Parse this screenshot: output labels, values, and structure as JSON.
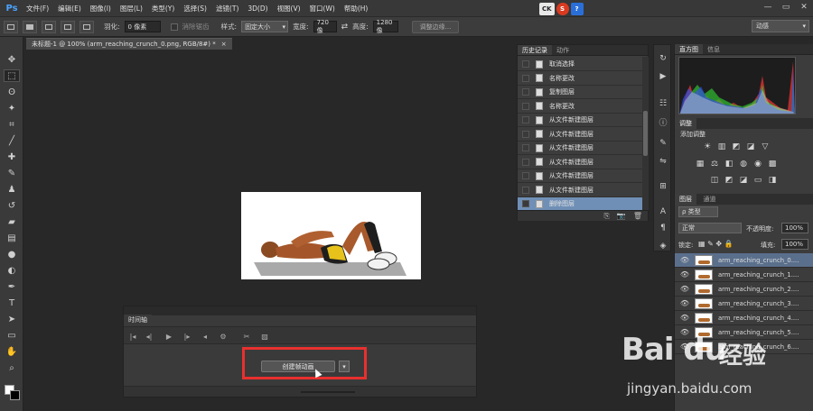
{
  "app": {
    "logo": "Ps",
    "menu": [
      "文件(F)",
      "编辑(E)",
      "图像(I)",
      "图层(L)",
      "类型(Y)",
      "选择(S)",
      "滤镜(T)",
      "3D(D)",
      "视图(V)",
      "窗口(W)",
      "帮助(H)"
    ],
    "tray": [
      "CK",
      "S",
      "?"
    ],
    "window_controls": [
      "—",
      "▭",
      "✕"
    ]
  },
  "options": {
    "feather_label": "羽化:",
    "feather_value": "0 像素",
    "antialias_label": "消除锯齿",
    "style_label": "样式:",
    "style_value": "固定大小",
    "width_label": "宽度:",
    "width_value": "720 像",
    "swap_icon": "⇄",
    "height_label": "高度:",
    "height_value": "1280 像",
    "refine_edge": "调整边缘...",
    "workspace": "动感"
  },
  "document": {
    "tab_title": "未标题-1 @ 100% (arm_reaching_crunch_0.png, RGB/8#) *",
    "close": "×"
  },
  "history": {
    "tabs": [
      "历史记录",
      "动作"
    ],
    "items": [
      "取消选择",
      "名称更改",
      "复制图层",
      "名称更改",
      "从文件新建图层",
      "从文件新建图层",
      "从文件新建图层",
      "从文件新建图层",
      "从文件新建图层",
      "从文件新建图层",
      "删除图层"
    ],
    "selected_index": 10,
    "footer_icons": [
      "⎘",
      "📷",
      "🗑"
    ]
  },
  "right": {
    "histogram_tabs": [
      "直方图",
      "信息"
    ],
    "adjust_tab": "调整",
    "adjust_title": "添加调整",
    "layers_tabs": [
      "图层",
      "通道"
    ],
    "kind_value": "ρ 类型",
    "blend_value": "正常",
    "opacity_label": "不透明度:",
    "opacity_value": "100%",
    "lock_label": "锁定:",
    "fill_label": "填充:",
    "fill_value": "100%",
    "layers": [
      "arm_reaching_crunch_0....",
      "arm_reaching_crunch_1....",
      "arm_reaching_crunch_2....",
      "arm_reaching_crunch_3....",
      "arm_reaching_crunch_4....",
      "arm_reaching_crunch_5....",
      "arm_reaching_crunch_6...."
    ]
  },
  "timeline": {
    "tab": "时间轴",
    "create_button": "创建帧动画",
    "dropdown": "▾",
    "controls": [
      "|◂",
      "◂|",
      "▶",
      "|▸",
      "◂",
      "⚙",
      "✂",
      "▨"
    ]
  },
  "watermark": {
    "brand": "Bai du",
    "jingyan": "经验",
    "url": "jingyan.baidu.com"
  }
}
